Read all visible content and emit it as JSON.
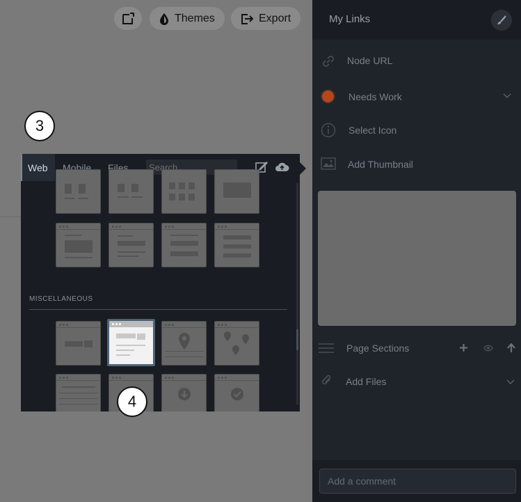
{
  "toolbar": {
    "themes_label": "Themes",
    "export_label": "Export"
  },
  "steps": {
    "step3": "3",
    "step4": "4"
  },
  "picker": {
    "tabs": [
      "Web",
      "Mobile",
      "Files"
    ],
    "active_tab": "Web",
    "search_placeholder": "Search",
    "section_label": "MISCELLANEOUS"
  },
  "sidebar": {
    "title": "My Links",
    "node_url": "Node URL",
    "status": "Needs Work",
    "status_color": "#b4471a",
    "select_icon": "Select Icon",
    "add_thumbnail": "Add Thumbnail",
    "page_sections": "Page Sections",
    "add_files": "Add Files",
    "comment_placeholder": "Add a comment"
  },
  "colors": {
    "canvas": "#7a7a7a",
    "sidebar": "#1f232a",
    "picker": "#191c22",
    "selection_border": "#4f6378"
  }
}
